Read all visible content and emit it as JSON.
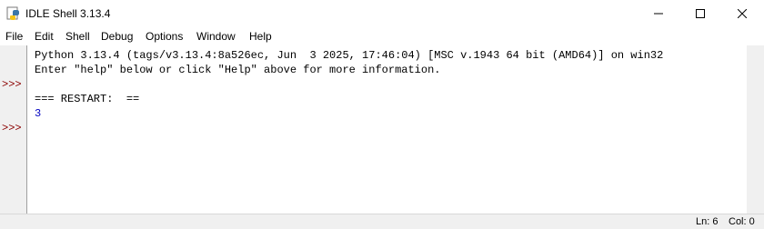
{
  "window": {
    "title": "IDLE Shell 3.13.4",
    "icon": "python-idle-icon"
  },
  "menubar": {
    "items": [
      "File",
      "Edit",
      "Shell",
      "Debug",
      "Options",
      "Window",
      "Help"
    ]
  },
  "shell": {
    "banner_line1": "Python 3.13.4 (tags/v3.13.4:8a526ec, Jun  3 2025, 17:46:04) [MSC v.1943 64 bit (AMD64)] on win32",
    "banner_line2": "Enter \"help\" below or click \"Help\" above for more information.",
    "restart_line": "=== RESTART:  ==",
    "output_line": "3",
    "prompt": ">>>",
    "output_color": "#0000c0",
    "prompt_color": "#8b0000"
  },
  "status": {
    "line": "Ln: 6",
    "col": "Col: 0"
  }
}
